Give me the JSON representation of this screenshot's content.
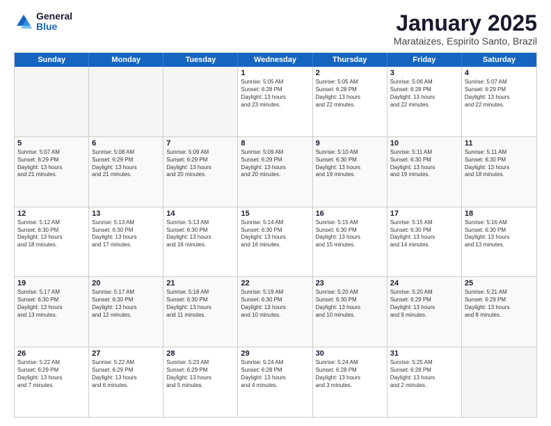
{
  "logo": {
    "general": "General",
    "blue": "Blue"
  },
  "title": {
    "month": "January 2025",
    "location": "Marataizes, Espirito Santo, Brazil"
  },
  "weekdays": [
    "Sunday",
    "Monday",
    "Tuesday",
    "Wednesday",
    "Thursday",
    "Friday",
    "Saturday"
  ],
  "weeks": [
    [
      {
        "day": "",
        "text": ""
      },
      {
        "day": "",
        "text": ""
      },
      {
        "day": "",
        "text": ""
      },
      {
        "day": "1",
        "text": "Sunrise: 5:05 AM\nSunset: 6:28 PM\nDaylight: 13 hours\nand 23 minutes."
      },
      {
        "day": "2",
        "text": "Sunrise: 5:05 AM\nSunset: 6:28 PM\nDaylight: 13 hours\nand 22 minutes."
      },
      {
        "day": "3",
        "text": "Sunrise: 5:06 AM\nSunset: 6:28 PM\nDaylight: 13 hours\nand 22 minutes."
      },
      {
        "day": "4",
        "text": "Sunrise: 5:07 AM\nSunset: 6:29 PM\nDaylight: 13 hours\nand 22 minutes."
      }
    ],
    [
      {
        "day": "5",
        "text": "Sunrise: 5:07 AM\nSunset: 6:29 PM\nDaylight: 13 hours\nand 21 minutes."
      },
      {
        "day": "6",
        "text": "Sunrise: 5:08 AM\nSunset: 6:29 PM\nDaylight: 13 hours\nand 21 minutes."
      },
      {
        "day": "7",
        "text": "Sunrise: 5:09 AM\nSunset: 6:29 PM\nDaylight: 13 hours\nand 20 minutes."
      },
      {
        "day": "8",
        "text": "Sunrise: 5:09 AM\nSunset: 6:29 PM\nDaylight: 13 hours\nand 20 minutes."
      },
      {
        "day": "9",
        "text": "Sunrise: 5:10 AM\nSunset: 6:30 PM\nDaylight: 13 hours\nand 19 minutes."
      },
      {
        "day": "10",
        "text": "Sunrise: 5:11 AM\nSunset: 6:30 PM\nDaylight: 13 hours\nand 19 minutes."
      },
      {
        "day": "11",
        "text": "Sunrise: 5:11 AM\nSunset: 6:30 PM\nDaylight: 13 hours\nand 18 minutes."
      }
    ],
    [
      {
        "day": "12",
        "text": "Sunrise: 5:12 AM\nSunset: 6:30 PM\nDaylight: 13 hours\nand 18 minutes."
      },
      {
        "day": "13",
        "text": "Sunrise: 5:13 AM\nSunset: 6:30 PM\nDaylight: 13 hours\nand 17 minutes."
      },
      {
        "day": "14",
        "text": "Sunrise: 5:13 AM\nSunset: 6:30 PM\nDaylight: 13 hours\nand 16 minutes."
      },
      {
        "day": "15",
        "text": "Sunrise: 5:14 AM\nSunset: 6:30 PM\nDaylight: 13 hours\nand 16 minutes."
      },
      {
        "day": "16",
        "text": "Sunrise: 5:15 AM\nSunset: 6:30 PM\nDaylight: 13 hours\nand 15 minutes."
      },
      {
        "day": "17",
        "text": "Sunrise: 5:15 AM\nSunset: 6:30 PM\nDaylight: 13 hours\nand 14 minutes."
      },
      {
        "day": "18",
        "text": "Sunrise: 5:16 AM\nSunset: 6:30 PM\nDaylight: 13 hours\nand 13 minutes."
      }
    ],
    [
      {
        "day": "19",
        "text": "Sunrise: 5:17 AM\nSunset: 6:30 PM\nDaylight: 13 hours\nand 13 minutes."
      },
      {
        "day": "20",
        "text": "Sunrise: 5:17 AM\nSunset: 6:30 PM\nDaylight: 13 hours\nand 12 minutes."
      },
      {
        "day": "21",
        "text": "Sunrise: 5:18 AM\nSunset: 6:30 PM\nDaylight: 13 hours\nand 11 minutes."
      },
      {
        "day": "22",
        "text": "Sunrise: 5:19 AM\nSunset: 6:30 PM\nDaylight: 13 hours\nand 10 minutes."
      },
      {
        "day": "23",
        "text": "Sunrise: 5:20 AM\nSunset: 6:30 PM\nDaylight: 13 hours\nand 10 minutes."
      },
      {
        "day": "24",
        "text": "Sunrise: 5:20 AM\nSunset: 6:29 PM\nDaylight: 13 hours\nand 9 minutes."
      },
      {
        "day": "25",
        "text": "Sunrise: 5:21 AM\nSunset: 6:29 PM\nDaylight: 13 hours\nand 8 minutes."
      }
    ],
    [
      {
        "day": "26",
        "text": "Sunrise: 5:22 AM\nSunset: 6:29 PM\nDaylight: 13 hours\nand 7 minutes."
      },
      {
        "day": "27",
        "text": "Sunrise: 5:22 AM\nSunset: 6:29 PM\nDaylight: 13 hours\nand 6 minutes."
      },
      {
        "day": "28",
        "text": "Sunrise: 5:23 AM\nSunset: 6:29 PM\nDaylight: 13 hours\nand 5 minutes."
      },
      {
        "day": "29",
        "text": "Sunrise: 5:24 AM\nSunset: 6:28 PM\nDaylight: 13 hours\nand 4 minutes."
      },
      {
        "day": "30",
        "text": "Sunrise: 5:24 AM\nSunset: 6:28 PM\nDaylight: 13 hours\nand 3 minutes."
      },
      {
        "day": "31",
        "text": "Sunrise: 5:25 AM\nSunset: 6:28 PM\nDaylight: 13 hours\nand 2 minutes."
      },
      {
        "day": "",
        "text": ""
      }
    ]
  ]
}
